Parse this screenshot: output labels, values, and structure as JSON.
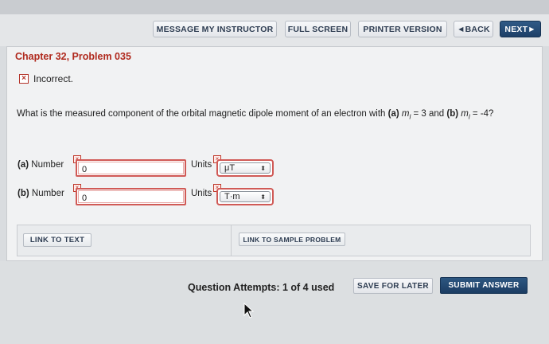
{
  "toolbar": {
    "message_instructor": "MESSAGE MY INSTRUCTOR",
    "full_screen": "FULL SCREEN",
    "printer_version": "PRINTER VERSION",
    "back": "BACK",
    "next": "NEXT"
  },
  "problem": {
    "title": "Chapter 32, Problem 035",
    "status": "Incorrect.",
    "question_prefix": "What is the measured component of the orbital magnetic dipole moment of an electron with",
    "part_a_label": "(a)",
    "part_a_var": "m",
    "part_a_sub": "l",
    "part_a_value": " = 3 and ",
    "part_b_label": "(b)",
    "part_b_var": "m",
    "part_b_sub": "l",
    "part_b_value": " = -4?"
  },
  "answers": [
    {
      "part": "(a)",
      "number_label": "Number",
      "value": "0",
      "units_label": "Units",
      "unit": "μT"
    },
    {
      "part": "(b)",
      "number_label": "Number",
      "value": "0",
      "units_label": "Units",
      "unit": "T·m"
    }
  ],
  "links": {
    "link_to_text": "LINK TO TEXT",
    "link_to_sample": "LINK TO SAMPLE PROBLEM"
  },
  "footer": {
    "attempts": "Question Attempts: 1 of 4 used",
    "save_for_later": "SAVE FOR LATER",
    "submit_answer": "SUBMIT ANSWER"
  },
  "colors": {
    "accent": "#1e4068",
    "error": "#b02a1e"
  },
  "icons": {
    "incorrect": "x-mark-icon",
    "back": "left-arrow-icon",
    "next": "right-arrow-icon",
    "select": "up-down-icon",
    "cursor": "mouse-pointer-icon"
  }
}
